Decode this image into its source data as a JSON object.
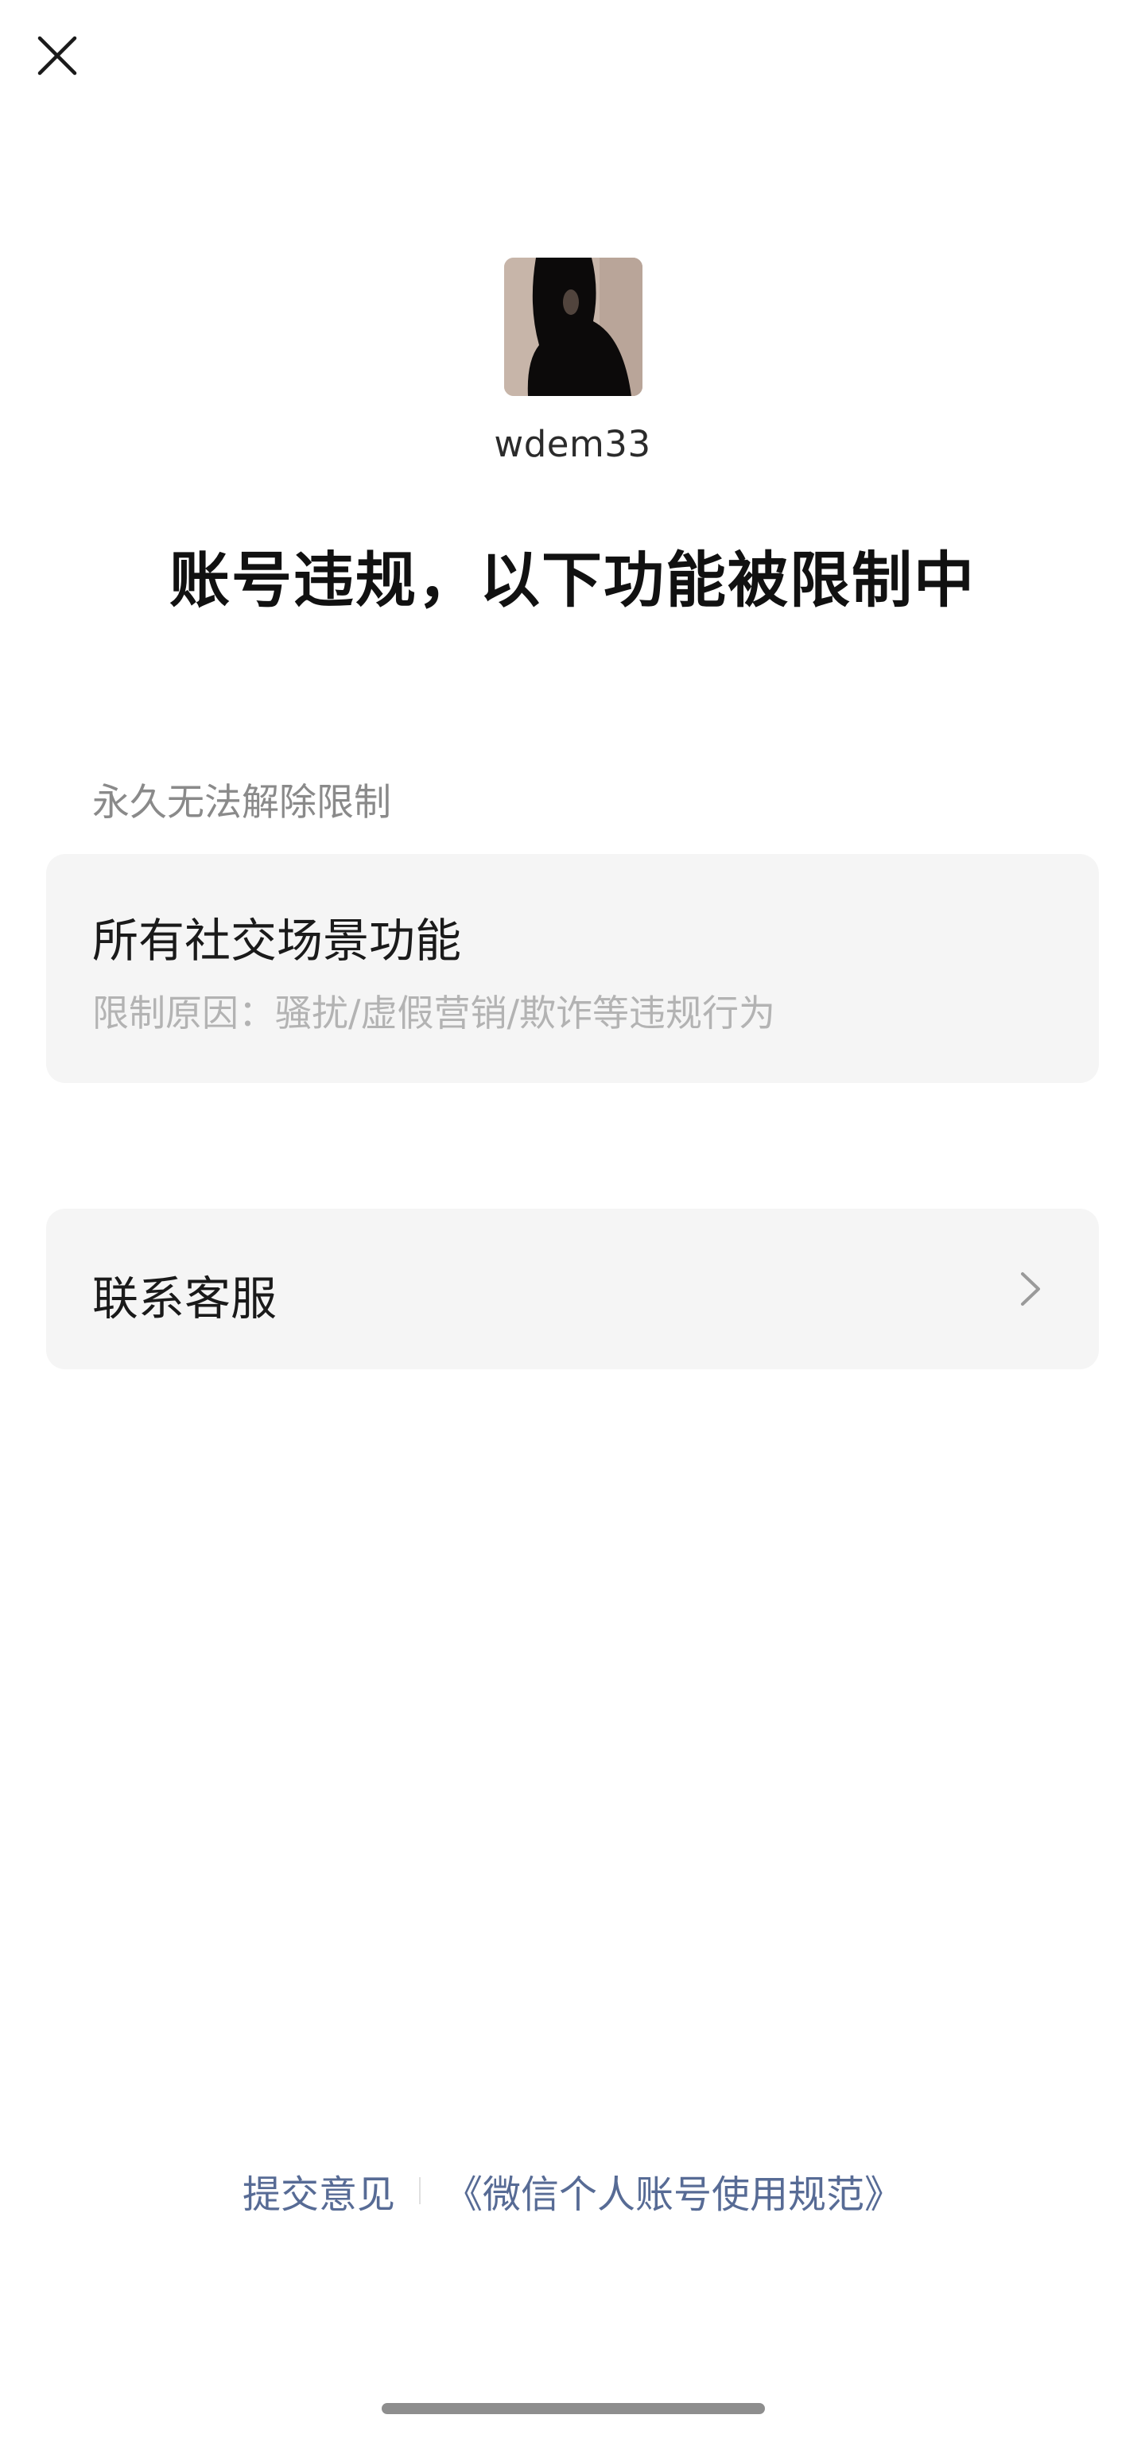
{
  "header": {
    "close_icon": "close-icon"
  },
  "profile": {
    "username": "wdem33"
  },
  "headline": "账号违规，以下功能被限制中",
  "restriction_section": {
    "label": "永久无法解除限制",
    "item": {
      "title": "所有社交场景功能",
      "reason": "限制原因：骚扰/虚假营销/欺诈等违规行为"
    }
  },
  "contact": {
    "label": "联系客服",
    "icon": "chevron-right-icon"
  },
  "footer": {
    "feedback_link": "提交意见",
    "policy_link": "《微信个人账号使用规范》"
  },
  "colors": {
    "link": "#576b95",
    "card_bg": "#f5f5f5",
    "muted_text": "#8a8a8a",
    "reason_text": "#b3b3b3"
  }
}
